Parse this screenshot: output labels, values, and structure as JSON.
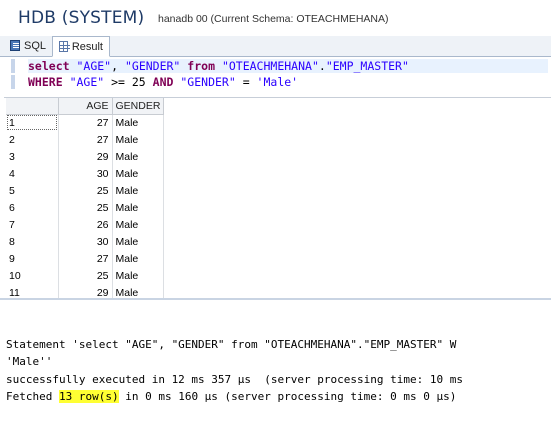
{
  "header": {
    "title": "HDB (SYSTEM)",
    "detail": "hanadb 00 (Current Schema: OTEACHMEHANA)"
  },
  "tabs": [
    {
      "label": "SQL",
      "icon": "sql-editor-icon",
      "active": false
    },
    {
      "label": "Result",
      "icon": "result-grid-icon",
      "active": true
    }
  ],
  "query": {
    "line1": [
      {
        "t": "select",
        "k": "kw"
      },
      {
        "t": " ",
        "k": "plain"
      },
      {
        "t": "\"AGE\"",
        "k": "str"
      },
      {
        "t": ", ",
        "k": "plain"
      },
      {
        "t": "\"GENDER\"",
        "k": "str"
      },
      {
        "t": " ",
        "k": "plain"
      },
      {
        "t": "from",
        "k": "kw"
      },
      {
        "t": " ",
        "k": "plain"
      },
      {
        "t": "\"OTEACHMEHANA\"",
        "k": "str"
      },
      {
        "t": ".",
        "k": "plain"
      },
      {
        "t": "\"EMP_MASTER\"",
        "k": "str"
      }
    ],
    "line2": [
      {
        "t": "WHERE",
        "k": "kw"
      },
      {
        "t": " ",
        "k": "plain"
      },
      {
        "t": "\"AGE\"",
        "k": "str"
      },
      {
        "t": " >= 25 ",
        "k": "plain"
      },
      {
        "t": "AND",
        "k": "kw"
      },
      {
        "t": " ",
        "k": "plain"
      },
      {
        "t": "\"GENDER\"",
        "k": "str"
      },
      {
        "t": " = ",
        "k": "plain"
      },
      {
        "t": "'Male'",
        "k": "str"
      }
    ]
  },
  "grid": {
    "columns": [
      "",
      "AGE",
      "GENDER"
    ],
    "rows": [
      [
        "1",
        "27",
        "Male"
      ],
      [
        "2",
        "27",
        "Male"
      ],
      [
        "3",
        "29",
        "Male"
      ],
      [
        "4",
        "30",
        "Male"
      ],
      [
        "5",
        "25",
        "Male"
      ],
      [
        "6",
        "25",
        "Male"
      ],
      [
        "7",
        "26",
        "Male"
      ],
      [
        "8",
        "30",
        "Male"
      ],
      [
        "9",
        "27",
        "Male"
      ],
      [
        "10",
        "25",
        "Male"
      ],
      [
        "11",
        "29",
        "Male"
      ]
    ]
  },
  "console": {
    "line1": "Statement 'select \"AGE\", \"GENDER\" from \"OTEACHMEHANA\".\"EMP_MASTER\" W",
    "line2": "'Male''",
    "line3": "successfully executed in 12 ms 357 µs  (server processing time: 10 ms",
    "line4_pre": "Fetched ",
    "line4_hl": "13 row(s)",
    "line4_post": " in 0 ms 160 µs (server processing time: 0 ms 0 µs)",
    "highlight_color": "#ffff33"
  }
}
